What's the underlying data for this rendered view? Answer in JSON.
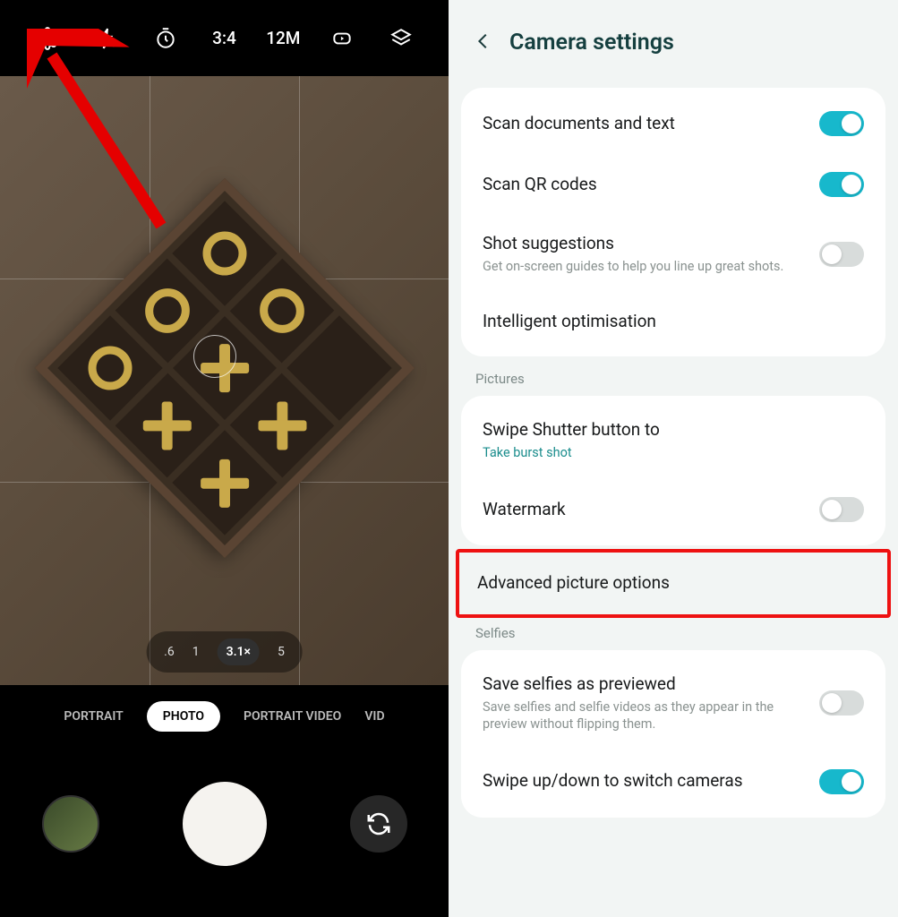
{
  "camera": {
    "toolbar": {
      "aspect_ratio": "3:4",
      "resolution": "12M"
    },
    "zoom": {
      "z1": ".6",
      "z2": "1",
      "active": "3.1×",
      "z3": "5"
    },
    "modes": {
      "m1": "PORTRAIT",
      "m2": "PHOTO",
      "m3": "PORTRAIT VIDEO",
      "m4": "VID"
    }
  },
  "settings": {
    "title": "Camera settings",
    "rows": {
      "scan_docs": {
        "title": "Scan documents and text",
        "on": true
      },
      "scan_qr": {
        "title": "Scan QR codes",
        "on": true
      },
      "shot_sugg": {
        "title": "Shot suggestions",
        "sub": "Get on-screen guides to help you line up great shots.",
        "on": false
      },
      "intel_opt": {
        "title": "Intelligent optimisation"
      },
      "pictures_label": "Pictures",
      "swipe_shutter": {
        "title": "Swipe Shutter button to",
        "sub": "Take burst shot"
      },
      "watermark": {
        "title": "Watermark",
        "on": false
      },
      "adv_picture": {
        "title": "Advanced picture options"
      },
      "selfies_label": "Selfies",
      "save_selfies": {
        "title": "Save selfies as previewed",
        "sub": "Save selfies and selfie videos as they appear in the preview without flipping them.",
        "on": false
      },
      "swipe_switch": {
        "title": "Swipe up/down to switch cameras",
        "on": true
      }
    }
  }
}
